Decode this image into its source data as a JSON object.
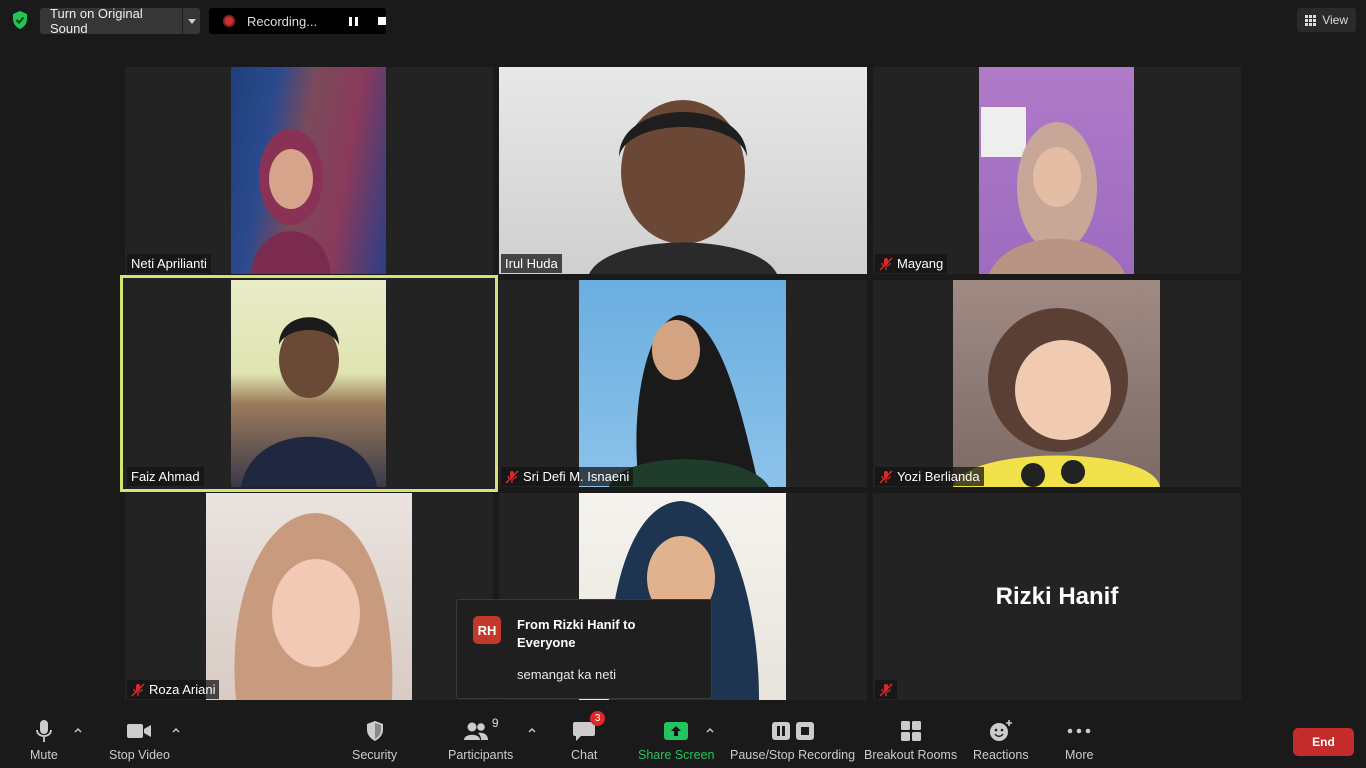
{
  "topbar": {
    "original_sound_label": "Turn on Original Sound",
    "recording_label": "Recording...",
    "view_label": "View"
  },
  "participants": [
    {
      "name": "Neti Aprilianti",
      "muted": false,
      "active": false
    },
    {
      "name": "Irul Huda",
      "muted": false,
      "active": false
    },
    {
      "name": "Mayang",
      "muted": true,
      "active": false
    },
    {
      "name": "Faiz Ahmad",
      "muted": false,
      "active": true
    },
    {
      "name": "Sri Defi M. Isnaeni",
      "muted": true,
      "active": false
    },
    {
      "name": "Yozi Berlianda",
      "muted": true,
      "active": false
    },
    {
      "name": "Roza Ariani",
      "muted": true,
      "active": false
    },
    {
      "name": "",
      "muted": false,
      "active": false
    },
    {
      "name": "Rizki Hanif",
      "muted": true,
      "active": false,
      "video_off": true
    }
  ],
  "chat_popup": {
    "avatar_initials": "RH",
    "from": "From Rizki Hanif to Everyone",
    "message": "semangat ka neti"
  },
  "toolbar": {
    "mute_label": "Mute",
    "stop_video_label": "Stop Video",
    "security_label": "Security",
    "participants_label": "Participants",
    "participants_count": "9",
    "chat_label": "Chat",
    "chat_badge": "3",
    "share_screen_label": "Share Screen",
    "recording_label": "Pause/Stop Recording",
    "breakout_label": "Breakout Rooms",
    "reactions_label": "Reactions",
    "more_label": "More",
    "end_label": "End"
  },
  "colors": {
    "active_speaker_border": "#d7e276",
    "share_screen_green": "#22c55e",
    "end_red": "#c42b2b",
    "mute_icon_red": "#e02828",
    "shield_green": "#23c552"
  }
}
